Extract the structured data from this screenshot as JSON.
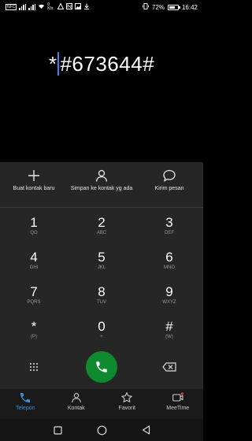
{
  "status_bar": {
    "nfc": "NFC",
    "network_speed": "0 K/s",
    "battery_percent": "72%",
    "battery_level": 0.72,
    "time": "16:42"
  },
  "display": {
    "number_before_caret": "*",
    "number_after_caret": "#673644#",
    "caret_color": "#3b82f6"
  },
  "actions": [
    {
      "label": "Buat kontak baru",
      "icon": "plus-icon"
    },
    {
      "label": "Simpan ke kontak yg ada",
      "icon": "person-icon"
    },
    {
      "label": "Kirim pesan",
      "icon": "message-icon"
    }
  ],
  "keys": [
    {
      "digit": "1",
      "sub": "QO"
    },
    {
      "digit": "2",
      "sub": "ABC"
    },
    {
      "digit": "3",
      "sub": "DEF"
    },
    {
      "digit": "4",
      "sub": "GHI"
    },
    {
      "digit": "5",
      "sub": "JKL"
    },
    {
      "digit": "6",
      "sub": "MNO"
    },
    {
      "digit": "7",
      "sub": "PQRS"
    },
    {
      "digit": "8",
      "sub": "TUV"
    },
    {
      "digit": "9",
      "sub": "WXYZ"
    },
    {
      "digit": "*",
      "sub": "(P)"
    },
    {
      "digit": "0",
      "sub": "+"
    },
    {
      "digit": "#",
      "sub": "(W)"
    }
  ],
  "call_row": {
    "left_icon": "dialpad-grid-icon",
    "call_icon": "phone-icon",
    "call_color": "#0f8a2e",
    "right_icon": "backspace-icon"
  },
  "tabs": [
    {
      "label": "Telepon",
      "icon": "phone-tab-icon",
      "active": true
    },
    {
      "label": "Kontak",
      "icon": "contacts-icon",
      "active": false
    },
    {
      "label": "Favorit",
      "icon": "star-icon",
      "active": false
    },
    {
      "label": "MeeTime",
      "icon": "video-call-icon",
      "active": false
    }
  ],
  "colors": {
    "accent": "#3a8ee6",
    "sheet": "#262626",
    "tabbar": "#1a1a1a"
  },
  "navbar": [
    "square-icon",
    "circle-icon",
    "back-triangle-icon"
  ]
}
